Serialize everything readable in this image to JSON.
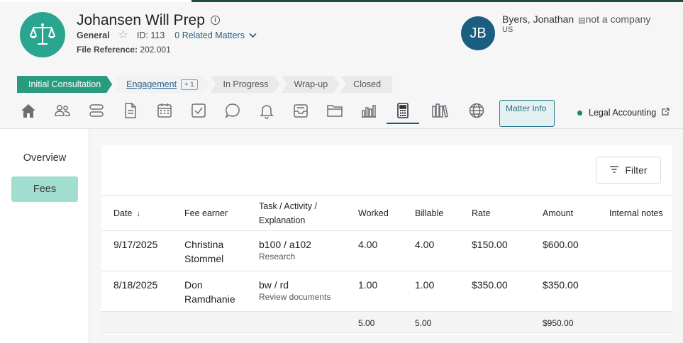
{
  "header": {
    "title": "Johansen Will Prep",
    "category": "General",
    "id_label": "ID: 113",
    "related_matters": "0 Related Matters",
    "file_ref_label": "File Reference:",
    "file_ref_value": "202.001"
  },
  "client": {
    "initials": "JB",
    "name": "Byers, Jonathan",
    "company": "not a company",
    "country": "US"
  },
  "stages": [
    {
      "label": "Initial Consultation",
      "state": "active"
    },
    {
      "label": "Engagement",
      "state": "current",
      "badge": "+ 1"
    },
    {
      "label": "In Progress",
      "state": "pending"
    },
    {
      "label": "Wrap-up",
      "state": "pending"
    },
    {
      "label": "Closed",
      "state": "pending"
    }
  ],
  "iconbar": {
    "icons": [
      "home-icon",
      "people-icon",
      "stack-icon",
      "document-icon",
      "calendar-icon",
      "checkbox-icon",
      "chat-icon",
      "bell-icon",
      "inbox-icon",
      "folder-icon",
      "bar-chart-icon",
      "calculator-icon",
      "books-icon",
      "globe-icon"
    ],
    "selected": "calculator-icon",
    "matter_info": "Matter Info",
    "legal_accounting": "Legal Accounting"
  },
  "sidebar": {
    "items": [
      {
        "label": "Overview",
        "active": false
      },
      {
        "label": "Fees",
        "active": true
      }
    ]
  },
  "fees": {
    "filter_label": "Filter",
    "columns": [
      "Date",
      "Fee earner",
      "Task / Activity / Explanation",
      "Worked",
      "Billable",
      "Rate",
      "Amount",
      "Internal notes"
    ],
    "rows": [
      {
        "date": "9/17/2025",
        "earner": "Christina Stommel",
        "task": "b100 / a102",
        "explanation": "Research",
        "worked": "4.00",
        "billable": "4.00",
        "rate": "$150.00",
        "amount": "$600.00",
        "notes": ""
      },
      {
        "date": "8/18/2025",
        "earner": "Don Ramdhanie",
        "task": "bw / rd",
        "explanation": "Review documents",
        "worked": "1.00",
        "billable": "1.00",
        "rate": "$350.00",
        "amount": "$350.00",
        "notes": ""
      }
    ],
    "totals": {
      "worked": "5.00",
      "billable": "5.00",
      "amount": "$950.00"
    }
  },
  "colors": {
    "accent": "#2a9b7f",
    "brand": "#1b5e80",
    "fees_active": "#a2ded0"
  }
}
